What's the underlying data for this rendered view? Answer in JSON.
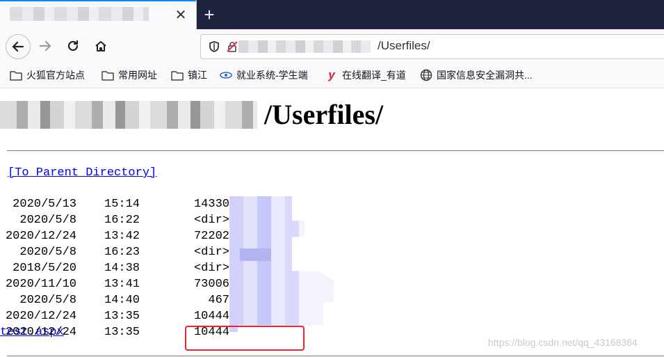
{
  "browser": {
    "tab": {
      "close_glyph": "✕"
    },
    "new_tab_glyph": "+",
    "url_path": "/Userfiles/"
  },
  "bookmarks": [
    {
      "label": "火狐官方站点",
      "icon": "folder-icon"
    },
    {
      "label": "常用网址",
      "icon": "folder-icon"
    },
    {
      "label": "镇江",
      "icon": "folder-icon"
    },
    {
      "label": "就业系统-学生端",
      "icon": "site-icon"
    },
    {
      "label": "在线翻译_有道",
      "icon": "youdao-icon"
    },
    {
      "label": "国家信息安全漏洞共...",
      "icon": "globe-icon"
    }
  ],
  "page": {
    "heading": "/Userfiles/",
    "parent_link": "[To Parent Directory]",
    "entries": [
      {
        "date": "2020/5/13",
        "time": "15:14",
        "size": "14330",
        "name": ""
      },
      {
        "date": "2020/5/8",
        "time": "16:22",
        "size": "<dir>",
        "name": ""
      },
      {
        "date": "2020/12/24",
        "time": "13:42",
        "size": "72202",
        "name": ""
      },
      {
        "date": "2020/5/8",
        "time": "16:23",
        "size": "<dir>",
        "name": ""
      },
      {
        "date": "2018/5/20",
        "time": "14:38",
        "size": "<dir>",
        "name": ""
      },
      {
        "date": "2020/11/10",
        "time": "13:41",
        "size": "73006",
        "name": ""
      },
      {
        "date": "2020/5/8",
        "time": "14:40",
        "size": "467",
        "name": ""
      },
      {
        "date": "2020/12/24",
        "time": "13:35",
        "size": "10444",
        "name": ""
      },
      {
        "date": "2020/12/24",
        "time": "13:35",
        "size": "10444",
        "name": "test.aspx"
      }
    ]
  },
  "watermark": "https://blog.csdn.net/qq_43168364",
  "colors": {
    "link": "#0000ee",
    "highlight": "#e8262c",
    "tabbar": "#202340"
  }
}
